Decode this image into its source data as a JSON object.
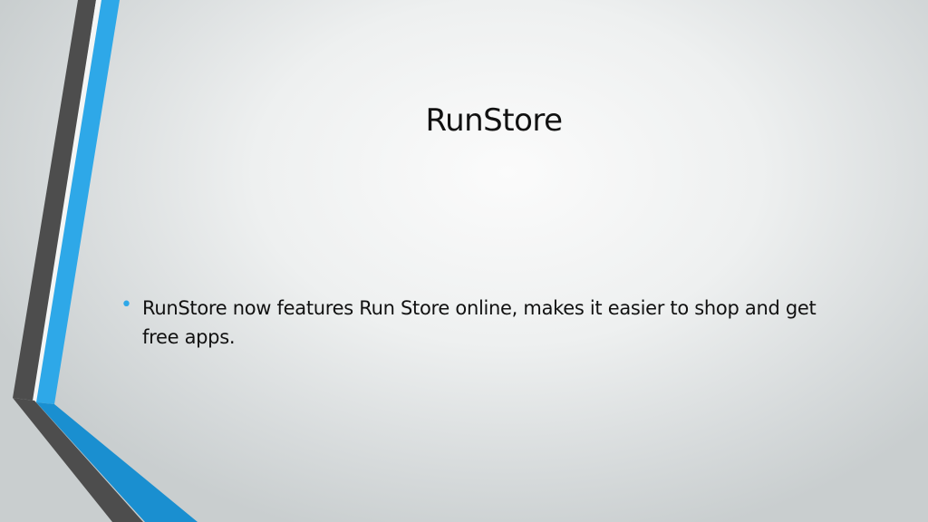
{
  "slide": {
    "title": "RunStore",
    "bullets": [
      {
        "text": "RunStore now features Run Store online, makes it easier to shop and get free apps."
      }
    ]
  },
  "theme": {
    "accent_blue": "#2ea8e8",
    "dark_gray": "#4d4d4d",
    "bullet_color": "#2ea8e8"
  },
  "icons": {
    "bullet": "bullet-dot-icon"
  }
}
